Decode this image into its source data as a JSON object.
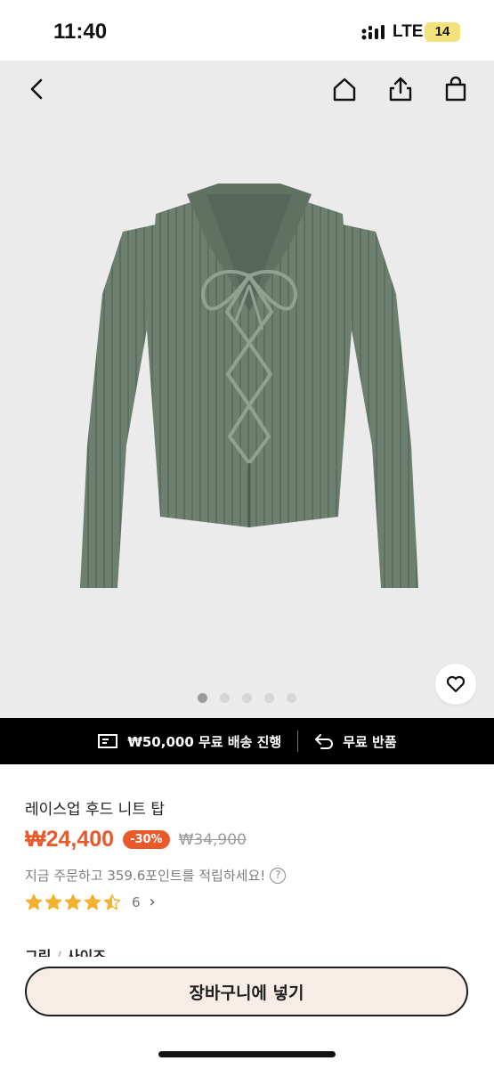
{
  "status_bar": {
    "time": "11:40",
    "network": "LTE",
    "battery": "14"
  },
  "nav": {
    "back_icon": "chevron-left-icon",
    "home_icon": "home-icon",
    "share_icon": "share-icon",
    "bag_icon": "shopping-bag-icon"
  },
  "gallery": {
    "total_images": 5,
    "active_index": 0,
    "wishlist_icon": "heart-icon"
  },
  "promo": {
    "shipping_text": "₩50,000 무료 배송 진행",
    "shipping_icon": "truck-icon",
    "return_text": "무료 반품",
    "return_icon": "return-arrow-icon"
  },
  "product": {
    "title": "레이스업 후드 니트 탑",
    "price": "₩24,400",
    "discount": "-30%",
    "original_price": "₩34,900",
    "points_text": "지금 주문하고 359.6포인트를 적립하세요!",
    "rating": 4.5,
    "review_count": "6"
  },
  "options": {
    "color_label": "그린",
    "separator": "/",
    "size_label": "사이즈"
  },
  "actions": {
    "add_to_cart": "장바구니에 넣기"
  },
  "colors": {
    "accent": "#e95a2a",
    "promo_bg": "#000000",
    "cart_bg": "#f8ece7",
    "cardigan": "#6c7f6f"
  }
}
